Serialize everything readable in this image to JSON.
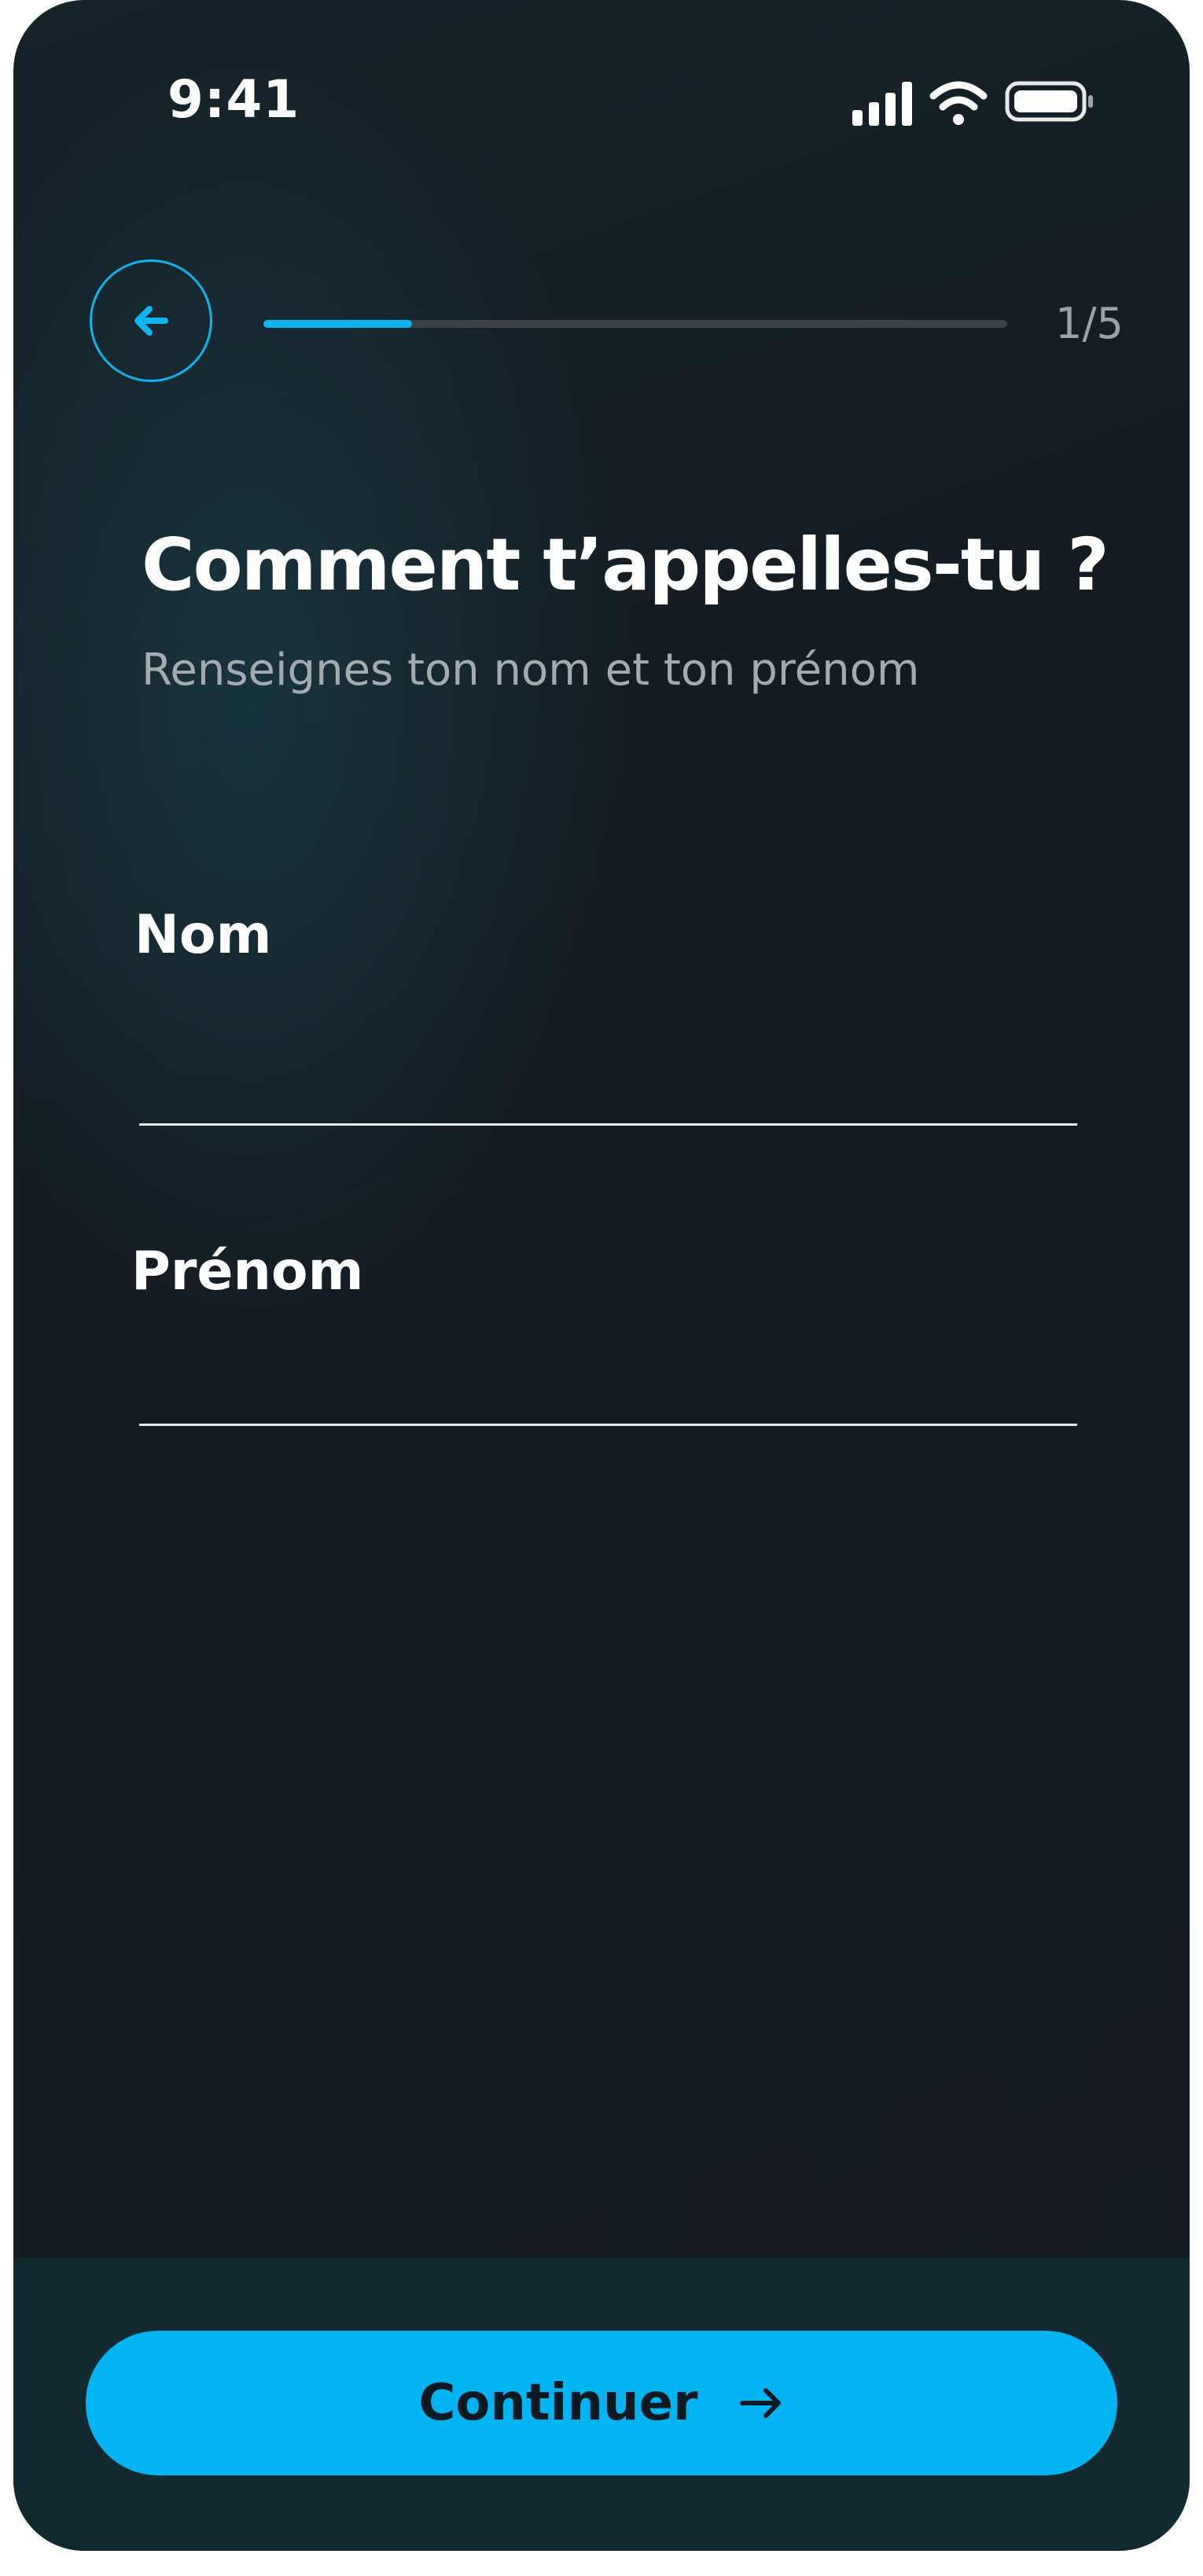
{
  "status_bar": {
    "time": "9:41",
    "icons": [
      "cellular-signal-icon",
      "wifi-icon",
      "battery-icon"
    ]
  },
  "header": {
    "back_icon": "arrow-left-icon",
    "progress": {
      "current": 1,
      "total": 5,
      "fraction": 0.2,
      "label": "1/5"
    }
  },
  "main": {
    "title": "Comment t’appelles-tu ?",
    "subtitle": "Renseignes ton nom et ton prénom",
    "fields": [
      {
        "label": "Nom",
        "value": "",
        "placeholder": ""
      },
      {
        "label": "Prénom",
        "value": "",
        "placeholder": ""
      }
    ]
  },
  "footer": {
    "continue_label": "Continuer",
    "continue_icon": "arrow-right-icon"
  },
  "colors": {
    "accent": "#03b4f2",
    "background": "#151c21",
    "footer_background": "#112a30",
    "text_primary": "#ffffff",
    "text_secondary": "#a3abb0"
  }
}
